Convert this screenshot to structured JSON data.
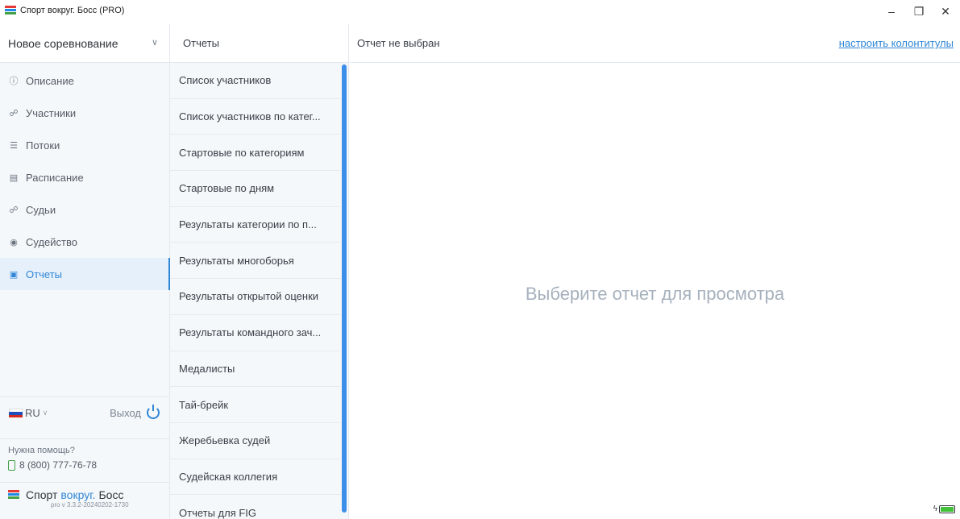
{
  "window": {
    "title": "Спорт вокруг. Босс (PRO)",
    "minimize": "–",
    "maximize": "❐",
    "close": "✕"
  },
  "sidebar": {
    "competition": "Новое соревнование",
    "chevron": "∨",
    "items": [
      {
        "label": "Описание",
        "icon": "info-icon",
        "glyph": "ⓘ"
      },
      {
        "label": "Участники",
        "icon": "participants-icon",
        "glyph": "☍"
      },
      {
        "label": "Потоки",
        "icon": "list-icon",
        "glyph": "☰"
      },
      {
        "label": "Расписание",
        "icon": "calendar-icon",
        "glyph": "▤"
      },
      {
        "label": "Судьи",
        "icon": "judges-icon",
        "glyph": "☍"
      },
      {
        "label": "Судейство",
        "icon": "play-circle-icon",
        "glyph": "◉"
      },
      {
        "label": "Отчеты",
        "icon": "document-icon",
        "glyph": "▣",
        "active": true
      }
    ],
    "language": "RU",
    "logout": "Выход",
    "help_label": "Нужна помощь?",
    "phone": "8 (800) 777-76-78",
    "brand": {
      "word1": "Спорт",
      "word2": "вокруг.",
      "word3": "Босс"
    },
    "version": "pro v 3.3.2-20240202-1730"
  },
  "reports": {
    "header": "Отчеты",
    "items": [
      "Список участников",
      "Список участников по катег...",
      "Стартовые по категориям",
      "Стартовые по дням",
      "Результаты категории по п...",
      "Результаты многоборья",
      "Результаты открытой оценки",
      "Результаты командного зач...",
      "Медалисты",
      "Тай-брейк",
      "Жеребьевка судей",
      "Судейская коллегия",
      "Отчеты для FIG"
    ]
  },
  "main": {
    "header": "Отчет не выбран",
    "header_link": "настроить колонтитулы",
    "placeholder": "Выберите отчет для просмотра"
  },
  "colors": {
    "accent": "#2f86d6",
    "scrollbar": "#3d8ee8",
    "placeholder": "#a6b1bd"
  }
}
